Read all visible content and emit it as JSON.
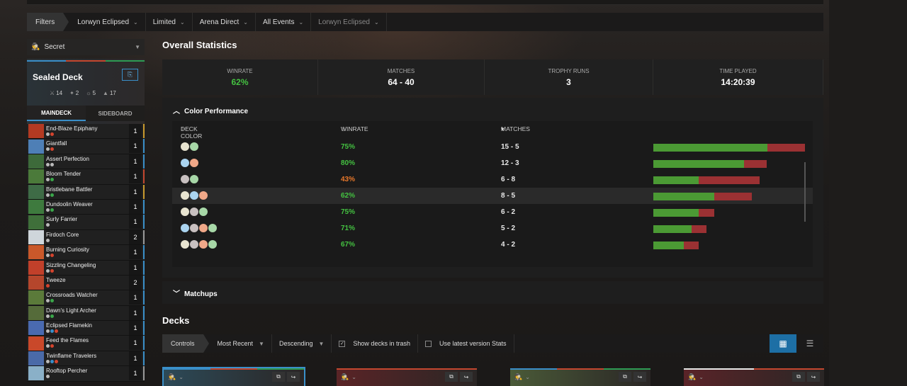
{
  "filters": {
    "label": "Filters",
    "items": [
      {
        "label": "Lorwyn Eclipsed",
        "dim": false
      },
      {
        "label": "Limited",
        "dim": false
      },
      {
        "label": "Arena Direct",
        "dim": false
      },
      {
        "label": "All Events",
        "dim": false
      },
      {
        "label": "Lorwyn Eclipsed",
        "dim": true
      }
    ]
  },
  "sidebar": {
    "visibility": "Secret",
    "deck_name": "Sealed Deck",
    "deck_colors": [
      "#3a8fc9",
      "#c4472f",
      "#2e9b54"
    ],
    "counts": [
      "14",
      "2",
      "5",
      "17"
    ],
    "tabs": [
      "MAINDECK",
      "SIDEBOARD"
    ],
    "cards": [
      {
        "name": "End-Blaze Epiphany",
        "qty": "1",
        "art": "#b33a22",
        "cost": [
          "#bbb",
          "#d4442e"
        ],
        "stripe": "#c99a2e"
      },
      {
        "name": "Giantfall",
        "qty": "1",
        "art": "#4e7fb6",
        "cost": [
          "#bbb",
          "#d4442e"
        ],
        "stripe": "#3a8fc9"
      },
      {
        "name": "Assert Perfection",
        "qty": "1",
        "art": "#3d6a3a",
        "cost": [
          "#bbb",
          "#bbb"
        ],
        "stripe": "#3a8fc9"
      },
      {
        "name": "Bloom Tender",
        "qty": "1",
        "art": "#4b7a3a",
        "cost": [
          "#bbb",
          "#3aa64a"
        ],
        "stripe": "#c4472f"
      },
      {
        "name": "Bristlebane Battler",
        "qty": "1",
        "art": "#3e6b46",
        "cost": [
          "#bbb",
          "#3aa64a"
        ],
        "stripe": "#c99a2e"
      },
      {
        "name": "Dundoolin Weaver",
        "qty": "1",
        "art": "#3e7a3e",
        "cost": [
          "#bbb",
          "#3aa64a"
        ],
        "stripe": "#3a8fc9"
      },
      {
        "name": "Surly Farrier",
        "qty": "1",
        "art": "#3f6f3a",
        "cost": [
          "#bbb"
        ],
        "stripe": "#3a8fc9"
      },
      {
        "name": "Firdoch Core",
        "qty": "2",
        "art": "#cfd6db",
        "cost": [
          "#bbb"
        ],
        "stripe": "#999999"
      },
      {
        "name": "Burning Curiosity",
        "qty": "1",
        "art": "#c9582a",
        "cost": [
          "#bbb",
          "#d4442e"
        ],
        "stripe": "#3a8fc9"
      },
      {
        "name": "Sizzling Changeling",
        "qty": "1",
        "art": "#c1402a",
        "cost": [
          "#bbb",
          "#d4442e"
        ],
        "stripe": "#3a8fc9"
      },
      {
        "name": "Tweeze",
        "qty": "2",
        "art": "#b5462c",
        "cost": [
          "#d4442e"
        ],
        "stripe": "#3a8fc9"
      },
      {
        "name": "Crossroads Watcher",
        "qty": "1",
        "art": "#5b7a3a",
        "cost": [
          "#bbb",
          "#3aa64a"
        ],
        "stripe": "#3a8fc9"
      },
      {
        "name": "Dawn's Light Archer",
        "qty": "1",
        "art": "#556b3a",
        "cost": [
          "#bbb",
          "#3aa64a"
        ],
        "stripe": "#3a8fc9"
      },
      {
        "name": "Eclipsed Flamekin",
        "qty": "1",
        "art": "#4a6ab0",
        "cost": [
          "#bbb",
          "#3a8fc9",
          "#d4442e"
        ],
        "stripe": "#3a8fc9"
      },
      {
        "name": "Feed the Flames",
        "qty": "1",
        "art": "#c9482a",
        "cost": [
          "#bbb",
          "#d4442e"
        ],
        "stripe": "#3a8fc9"
      },
      {
        "name": "Twinflame Travelers",
        "qty": "1",
        "art": "#4a6aa8",
        "cost": [
          "#bbb",
          "#3a8fc9",
          "#d4442e"
        ],
        "stripe": "#3a8fc9"
      },
      {
        "name": "Rooftop Percher",
        "qty": "1",
        "art": "#8ab0c8",
        "cost": [
          "#bbb"
        ],
        "stripe": "#999999"
      }
    ]
  },
  "overall": {
    "title": "Overall Statistics",
    "stats": [
      {
        "label": "WINRATE",
        "value": "62%",
        "green": true
      },
      {
        "label": "MATCHES",
        "value": "64 - 40",
        "green": false
      },
      {
        "label": "TROPHY RUNS",
        "value": "3",
        "green": false
      },
      {
        "label": "TIME PLAYED",
        "value": "14:20:39",
        "green": false
      }
    ]
  },
  "color_performance": {
    "title": "Color Performance",
    "columns": [
      "DECK COLOR",
      "WINRATE",
      "MATCHES"
    ],
    "rows": [
      {
        "colors": [
          "W",
          "G"
        ],
        "winrate": "75%",
        "matches": "15 - 5",
        "wins": 15,
        "losses": 5,
        "wr_color": "#44c241",
        "highlight": false
      },
      {
        "colors": [
          "U",
          "R"
        ],
        "winrate": "80%",
        "matches": "12 - 3",
        "wins": 12,
        "losses": 3,
        "wr_color": "#44c241",
        "highlight": false
      },
      {
        "colors": [
          "B",
          "G"
        ],
        "winrate": "43%",
        "matches": "6 - 8",
        "wins": 6,
        "losses": 8,
        "wr_color": "#e8782a",
        "highlight": false
      },
      {
        "colors": [
          "W",
          "U",
          "R"
        ],
        "winrate": "62%",
        "matches": "8 - 5",
        "wins": 8,
        "losses": 5,
        "wr_color": "#44c241",
        "highlight": true
      },
      {
        "colors": [
          "W",
          "B",
          "G"
        ],
        "winrate": "75%",
        "matches": "6 - 2",
        "wins": 6,
        "losses": 2,
        "wr_color": "#44c241",
        "highlight": false
      },
      {
        "colors": [
          "U",
          "B",
          "R",
          "G"
        ],
        "winrate": "71%",
        "matches": "5 - 2",
        "wins": 5,
        "losses": 2,
        "wr_color": "#44c241",
        "highlight": false
      },
      {
        "colors": [
          "W",
          "B",
          "R",
          "G"
        ],
        "winrate": "67%",
        "matches": "4 - 2",
        "wins": 4,
        "losses": 2,
        "wr_color": "#44c241",
        "highlight": false
      }
    ]
  },
  "matchups": {
    "title": "Matchups"
  },
  "decks": {
    "title": "Decks",
    "controls_label": "Controls",
    "sort": "Most Recent",
    "order": "Descending",
    "show_trash": "Show decks in trash",
    "show_trash_checked": true,
    "latest_version": "Use latest version Stats",
    "latest_version_checked": false,
    "cards": [
      {
        "selected": true,
        "colors": [
          "#3a8fc9",
          "#c4472f",
          "#2e9b54"
        ],
        "art": "#2d4a58"
      },
      {
        "selected": false,
        "colors": [
          "#c4472f",
          "#c4472f"
        ],
        "art": "#5a2426"
      },
      {
        "selected": false,
        "colors": [
          "#3a8fc9",
          "#c4472f",
          "#2e9b54"
        ],
        "art": "#4a5a38"
      },
      {
        "selected": false,
        "colors": [
          "#e8e8e8",
          "#c4472f"
        ],
        "art": "#5a2428"
      }
    ]
  }
}
